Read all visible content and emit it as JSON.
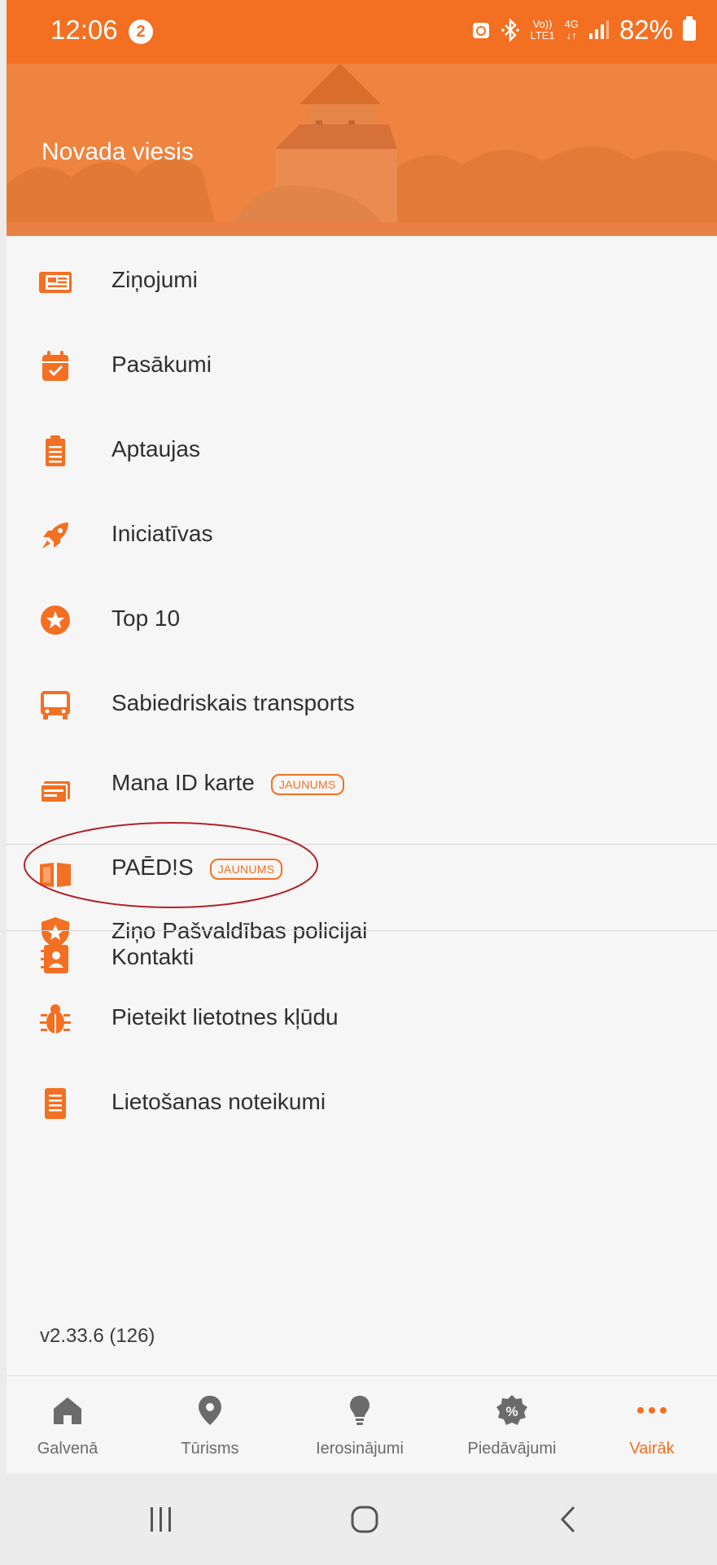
{
  "status_bar": {
    "time": "12:06",
    "notification_count": "2",
    "volte": "Vo))",
    "lte": "LTE1",
    "network": "4G",
    "battery": "82%"
  },
  "header": {
    "title": "Novada viesis"
  },
  "menu": {
    "items": [
      {
        "label": "Ziņojumi",
        "icon": "newspaper-icon"
      },
      {
        "label": "Pasākumi",
        "icon": "calendar-check-icon"
      },
      {
        "label": "Aptaujas",
        "icon": "clipboard-icon"
      },
      {
        "label": "Iniciatīvas",
        "icon": "rocket-icon"
      },
      {
        "label": "Top 10",
        "icon": "star-circle-icon"
      },
      {
        "label": "Sabiedriskais transports",
        "icon": "bus-icon"
      },
      {
        "label": "Mana ID karte",
        "icon": "id-card-icon",
        "badge": "JAUNUMS"
      },
      {
        "label": "PAĒD!S",
        "icon": "open-book-icon",
        "badge": "JAUNUMS"
      },
      {
        "label": "Kontakti",
        "icon": "contact-book-icon"
      },
      {
        "label": "Ziņo Pašvaldības policijai",
        "icon": "police-shield-icon"
      },
      {
        "label": "Pieteikt lietotnes kļūdu",
        "icon": "bug-icon"
      },
      {
        "label": "Lietošanas noteikumi",
        "icon": "document-icon"
      }
    ]
  },
  "version": "v2.33.6 (126)",
  "bottom_nav": {
    "tabs": [
      {
        "label": "Galvenā",
        "icon": "home-icon"
      },
      {
        "label": "Tūrisms",
        "icon": "map-pin-icon"
      },
      {
        "label": "Ierosinājumi",
        "icon": "lightbulb-icon"
      },
      {
        "label": "Piedāvājumi",
        "icon": "discount-badge-icon"
      },
      {
        "label": "Vairāk",
        "icon": "more-dots-icon"
      }
    ],
    "active_tab": "Vairāk"
  },
  "colors": {
    "accent": "#f37022",
    "banner": "#ee843f",
    "annotation": "#b0232a"
  }
}
